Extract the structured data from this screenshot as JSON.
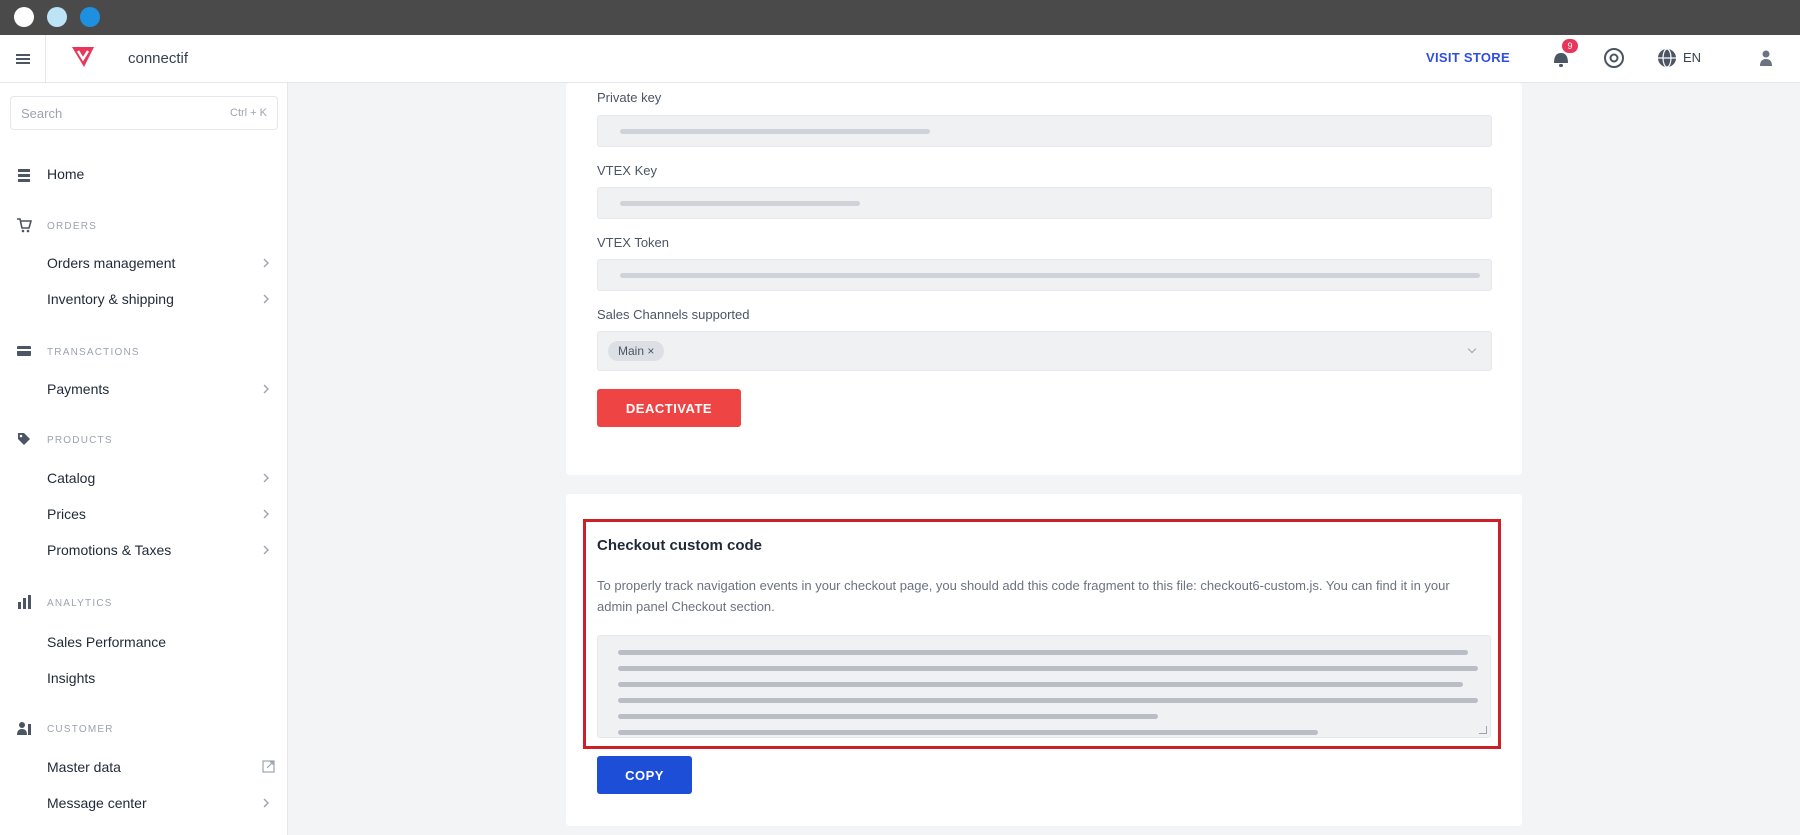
{
  "window": {
    "title": ""
  },
  "topbar": {
    "account": "connectif",
    "visit_store": "VISIT STORE",
    "notifications_count": "9",
    "language": "EN"
  },
  "sidebar": {
    "search_placeholder": "Search",
    "search_shortcut": "Ctrl + K",
    "home": "Home",
    "orders_section": "ORDERS",
    "orders_management": "Orders management",
    "inventory_shipping": "Inventory & shipping",
    "transactions_section": "TRANSACTIONS",
    "payments": "Payments",
    "products_section": "PRODUCTS",
    "catalog": "Catalog",
    "prices": "Prices",
    "promotions_taxes": "Promotions & Taxes",
    "analytics_section": "ANALYTICS",
    "sales_performance": "Sales Performance",
    "insights": "Insights",
    "customer_section": "CUSTOMER",
    "master_data": "Master data",
    "message_center": "Message center"
  },
  "main": {
    "private_key_label": "Private key",
    "vtex_key_label": "VTEX Key",
    "vtex_token_label": "VTEX Token",
    "sales_channels_label": "Sales Channels supported",
    "sales_channel_chip": "Main",
    "sales_channel_chip_remove": "×",
    "deactivate_label": "DEACTIVATE",
    "checkout_title": "Checkout custom code",
    "checkout_description": "To properly track navigation events in your checkout page, you should add this code fragment to this file: checkout6-custom.js. You can find it in your admin panel Checkout section.",
    "copy_label": "COPY"
  },
  "colors": {
    "primary": "#1d4ed8",
    "danger": "#ef4444",
    "highlight": "#cc1f27",
    "link": "#2f4ee0"
  },
  "icons": {
    "menu": "hamburger-icon",
    "logo": "vtex-logo",
    "notifications": "bell-icon",
    "help": "help-icon",
    "language": "globe-icon",
    "user": "user-icon"
  }
}
